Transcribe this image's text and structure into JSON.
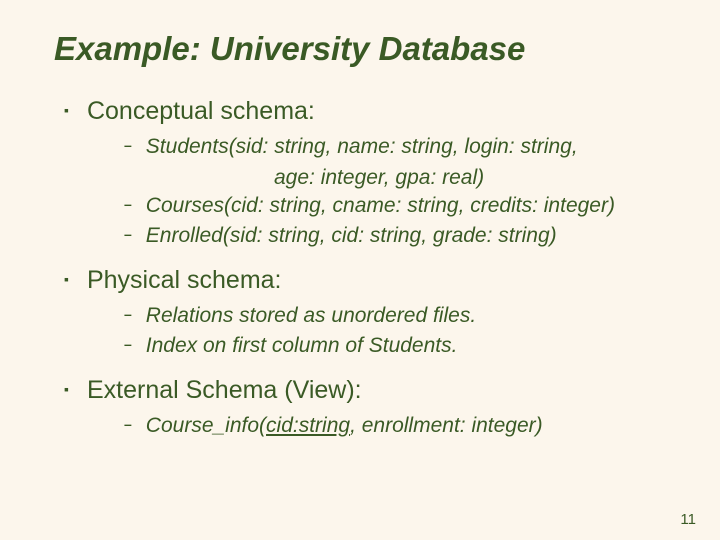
{
  "title": "Example: University Database",
  "sections": [
    {
      "heading": "Conceptual schema:",
      "items": [
        {
          "line1": "Students(sid: string, name: string, login: string,",
          "cont": "age: integer, gpa: real)"
        },
        {
          "line1": "Courses(cid: string, cname: string, credits: integer)"
        },
        {
          "line1": "Enrolled(sid: string, cid: string, grade: string)"
        }
      ]
    },
    {
      "heading": "Physical schema:",
      "items": [
        {
          "line1": "Relations stored as unordered files."
        },
        {
          "line1": "Index on first column of Students."
        }
      ]
    },
    {
      "heading": "External Schema (View):",
      "items": [
        {
          "prefix": "Course_info(",
          "uline": "cid:string",
          "suffix": ", enrollment: integer)"
        }
      ]
    }
  ],
  "page_number": "11"
}
